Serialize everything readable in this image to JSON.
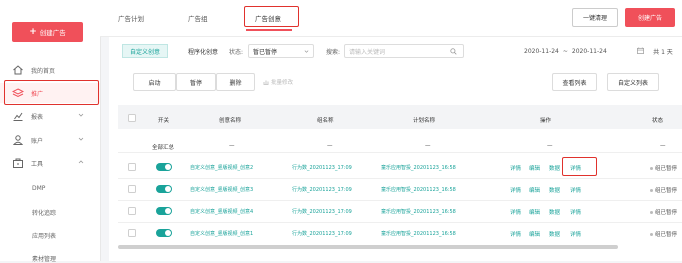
{
  "sidebar": {
    "create_label": "创建广告",
    "items": [
      {
        "label": "我的首页",
        "icon": "home-icon"
      },
      {
        "label": "推广",
        "icon": "layers-icon"
      },
      {
        "label": "报表",
        "icon": "chart-icon"
      },
      {
        "label": "账户",
        "icon": "user-icon"
      },
      {
        "label": "工具",
        "icon": "toolbox-icon"
      }
    ],
    "tool_sub": [
      "DMP",
      "转化追踪",
      "应用列表",
      "素材管理"
    ]
  },
  "tabs": [
    "广告计划",
    "广告组",
    "广告创意"
  ],
  "top_actions": {
    "clean": "一键清理",
    "create": "创建广告"
  },
  "filters": {
    "custom": "自定义创意",
    "programmatic": "程序化创意",
    "status_label": "状态:",
    "status_value": "暂已暂停",
    "search_label": "搜索:",
    "search_placeholder": "请输入关键词",
    "date_start": "2020-11-24",
    "date_sep": "~",
    "date_end": "2020-11-24",
    "total": "共 1 天"
  },
  "actions": {
    "start": "启动",
    "pause": "暂停",
    "delete": "删除",
    "edit_plan": "批量修改",
    "view_cols": "查看列表",
    "custom_cols": "自定义列表"
  },
  "columns": [
    "开关",
    "创意名称",
    "组名称",
    "计划名称",
    "操作",
    "状态"
  ],
  "summary": {
    "label": "全部汇总",
    "dash": "—"
  },
  "ops": [
    "详情",
    "编辑",
    "数据",
    "详情"
  ],
  "rows": [
    {
      "creative": "自定义创意_竖版视频_创意2",
      "group": "行为数_20201123_17:09",
      "plan": "童乐应用智投_20201123_16:58",
      "status": "组已暂停"
    },
    {
      "creative": "自定义创意_竖版视频_创意3",
      "group": "行为数_20201123_17:09",
      "plan": "童乐应用智投_20201123_16:58",
      "status": "组已暂停"
    },
    {
      "creative": "自定义创意_竖版视频_创意4",
      "group": "行为数_20201123_17:09",
      "plan": "童乐应用智投_20201123_16:58",
      "status": "组已暂停"
    },
    {
      "creative": "自定义创意_竖版视频_创意1",
      "group": "行为数_20201123_17:09",
      "plan": "童乐应用智投_20201123_16:58",
      "status": "组已暂停"
    }
  ],
  "colors": {
    "brand": "#f0505a",
    "accent": "#1aa39a",
    "highlight": "#e0322d"
  }
}
